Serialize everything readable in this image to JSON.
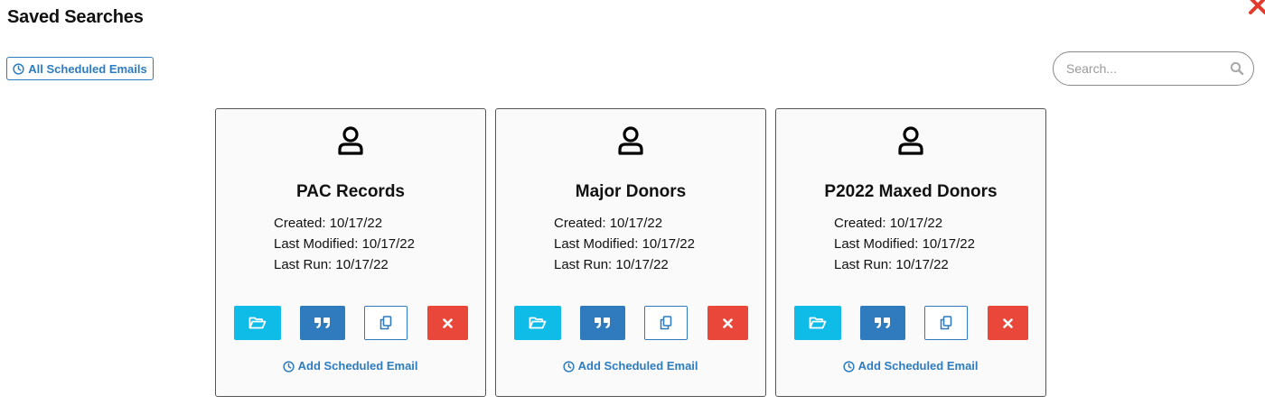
{
  "header": {
    "title": "Saved Searches",
    "all_scheduled_label": "All Scheduled Emails"
  },
  "search": {
    "placeholder": "Search...",
    "value": ""
  },
  "cards": [
    {
      "name": "PAC Records",
      "created_label": "Created:",
      "created": "10/17/22",
      "modified_label": "Last Modified:",
      "modified": "10/17/22",
      "run_label": "Last Run:",
      "run": "10/17/22",
      "add_scheduled_label": "Add Scheduled Email"
    },
    {
      "name": "Major Donors",
      "created_label": "Created:",
      "created": "10/17/22",
      "modified_label": "Last Modified:",
      "modified": "10/17/22",
      "run_label": "Last Run:",
      "run": "10/17/22",
      "add_scheduled_label": "Add Scheduled Email"
    },
    {
      "name": "P2022 Maxed Donors",
      "created_label": "Created:",
      "created": "10/17/22",
      "modified_label": "Last Modified:",
      "modified": "10/17/22",
      "run_label": "Last Run:",
      "run": "10/17/22",
      "add_scheduled_label": "Add Scheduled Email"
    }
  ],
  "icons": {
    "close": "close-icon",
    "clock": "clock-icon",
    "search": "search-icon",
    "person": "user-icon",
    "open": "folder-open-icon",
    "quote": "quote-icon",
    "copy": "copy-icon",
    "delete": "delete-icon"
  },
  "colors": {
    "accent": "#2d7cbf",
    "open_button": "#0fbce8",
    "quote_button": "#2f7bbe",
    "delete_button": "#e8473a",
    "close_icon": "#e23b2e"
  }
}
